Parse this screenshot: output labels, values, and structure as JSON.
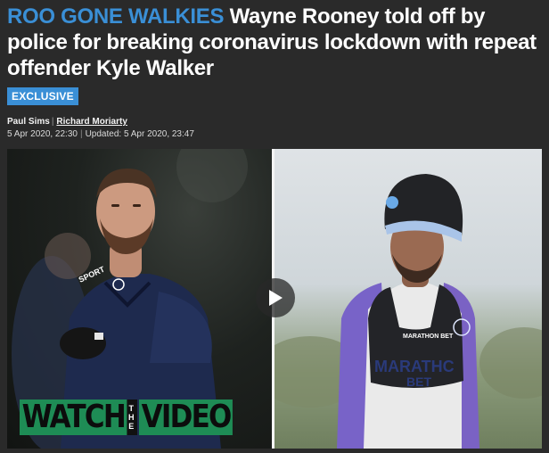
{
  "headline": {
    "kicker": "ROO GONE WALKIES",
    "title": "Wayne Rooney told off by police for breaking coronavirus lockdown with repeat offender Kyle Walker"
  },
  "tag": "EXCLUSIVE",
  "byline": {
    "author1": "Paul Sims",
    "author2": "Richard Moriarty",
    "published": "5 Apr 2020, 22:30",
    "updated": "Updated: 5 Apr 2020, 23:47"
  },
  "media": {
    "left_jersey_text": "SPORT",
    "right_sponsor_small": "MARATHON BET",
    "right_sponsor_large_1": "MARATHC",
    "right_sponsor_large_2": "BET",
    "banner": {
      "word1": "WATCH",
      "word2_letters": [
        "T",
        "H",
        "E"
      ],
      "word3": "VIDEO"
    },
    "play_icon": "play-icon",
    "colors": {
      "kicker": "#3a8fd6",
      "tag_bg": "#3a8fd6",
      "banner_green": "#1e8c55",
      "page_bg": "#2a2a2a"
    }
  }
}
